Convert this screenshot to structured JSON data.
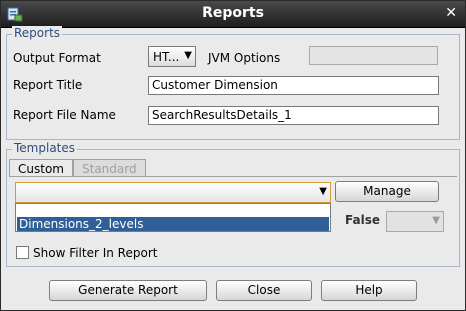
{
  "window": {
    "title": "Reports",
    "close_glyph": "✕"
  },
  "reports": {
    "section_title": "Reports",
    "output_format_label": "Output Format",
    "output_format_value": "HT...",
    "jvm_options_label": "JVM Options",
    "jvm_options_value": "",
    "report_title_label": "Report Title",
    "report_title_value": "Customer Dimension",
    "report_file_name_label": "Report File Name",
    "report_file_name_value": "SearchResultsDetails_1"
  },
  "templates": {
    "section_title": "Templates",
    "tabs": [
      {
        "label": "Custom",
        "active": true
      },
      {
        "label": "Standard",
        "active": false
      }
    ],
    "template_select_value": "",
    "manage_label": "Manage",
    "dropdown_options": [
      "Dimensions_2_levels"
    ],
    "false_label": "False",
    "false_select_value": "",
    "show_filter_label": "Show Filter In Report",
    "show_filter_checked": false
  },
  "footer": {
    "generate_label": "Generate Report",
    "close_label": "Close",
    "help_label": "Help"
  },
  "colors": {
    "accent": "#2c4f7a",
    "highlight": "#2f5f96",
    "titlebar": "#2a2a2a",
    "focus_border": "#d49a3a"
  }
}
